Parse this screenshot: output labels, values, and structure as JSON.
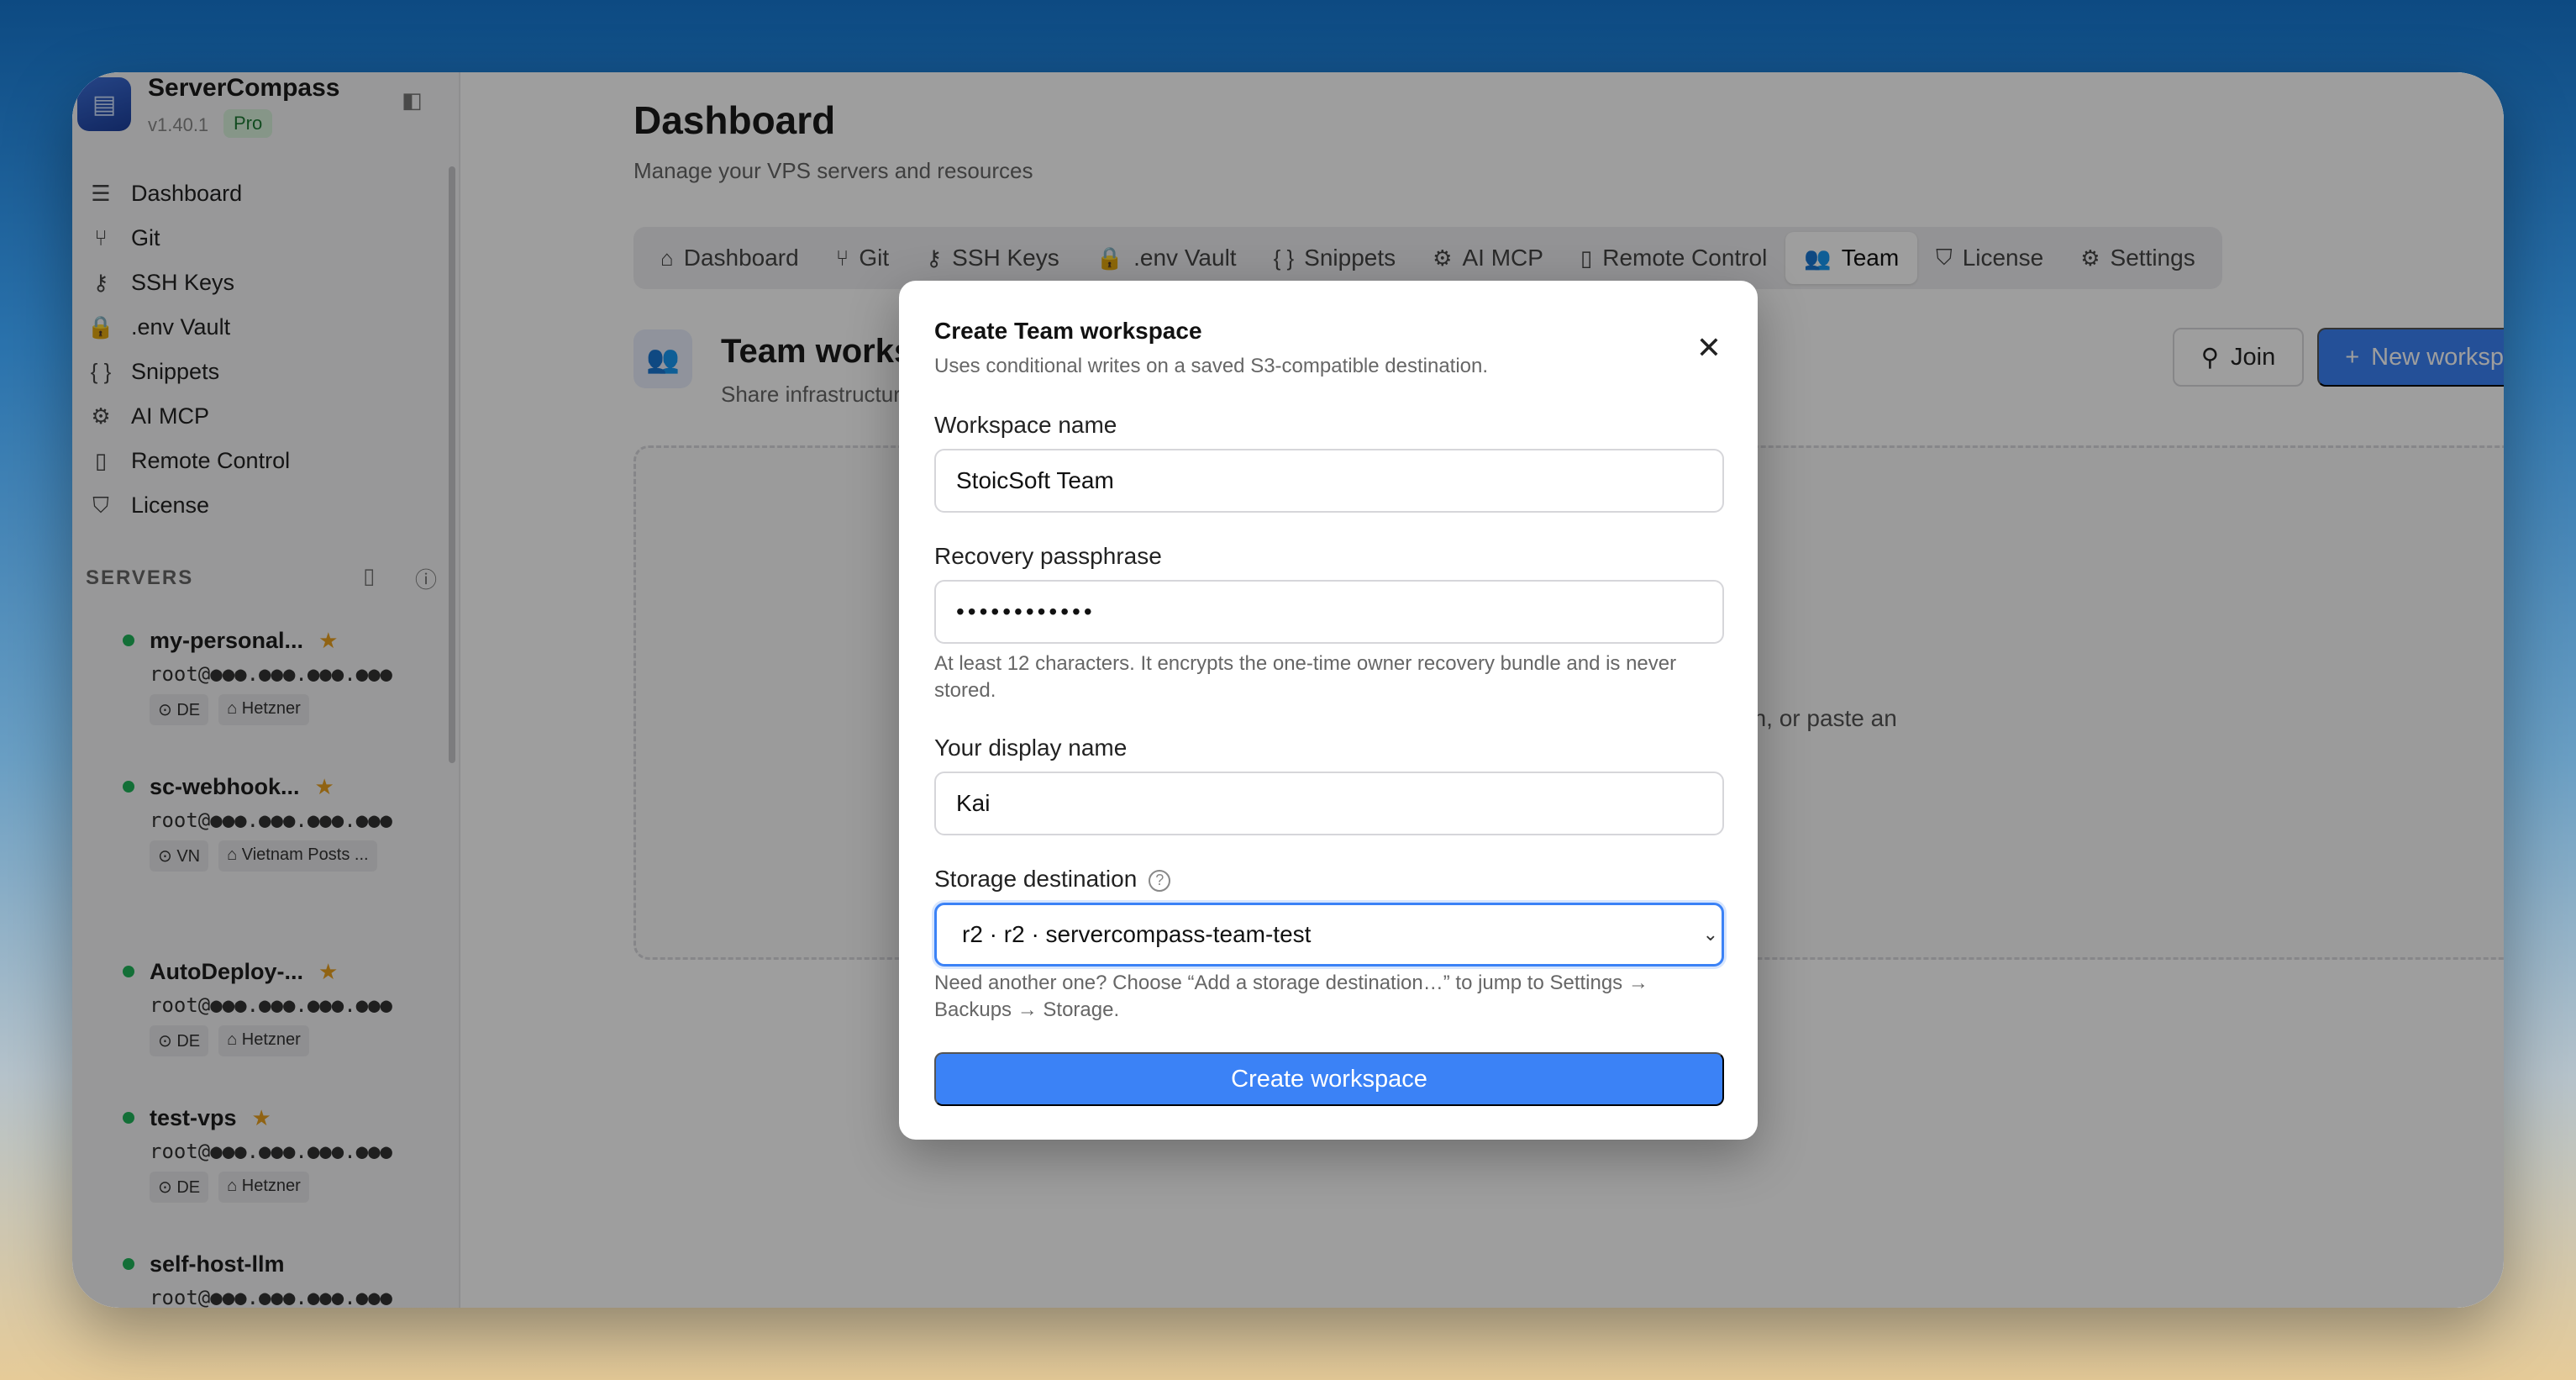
{
  "app": {
    "name": "ServerCompass",
    "version": "v1.40.1",
    "badge": "Pro"
  },
  "sidebar": {
    "nav": [
      {
        "label": "Dashboard",
        "icon": "server-stack-icon",
        "glyph": "☰"
      },
      {
        "label": "Git",
        "icon": "git-branch-icon",
        "glyph": "⑂"
      },
      {
        "label": "SSH Keys",
        "icon": "key-icon",
        "glyph": "⚷"
      },
      {
        "label": ".env Vault",
        "icon": "lock-icon",
        "glyph": "🔒"
      },
      {
        "label": "Snippets",
        "icon": "braces-icon",
        "glyph": "{ }"
      },
      {
        "label": "AI MCP",
        "icon": "robot-icon",
        "glyph": "⚙"
      },
      {
        "label": "Remote Control",
        "icon": "phone-icon",
        "glyph": "▯"
      },
      {
        "label": "License",
        "icon": "shield-icon",
        "glyph": "⛉"
      }
    ],
    "servers_title": "SERVERS",
    "servers": [
      {
        "name": "my-personal...",
        "host": "root@●●●.●●●.●●●.●●●",
        "tags": [
          "⊙ DE",
          "⌂ Hetzner"
        ]
      },
      {
        "name": "sc-webhook...",
        "host": "root@●●●.●●●.●●●.●●●",
        "tags": [
          "⊙ VN",
          "⌂ Vietnam Posts ..."
        ]
      },
      {
        "name": "AutoDeploy-...",
        "host": "root@●●●.●●●.●●●.●●●",
        "tags": [
          "⊙ DE",
          "⌂ Hetzner"
        ]
      },
      {
        "name": "test-vps",
        "host": "root@●●●.●●●.●●●.●●●",
        "tags": [
          "⊙ DE",
          "⌂ Hetzner"
        ]
      },
      {
        "name": "self-host-llm",
        "host": "root@●●●.●●●.●●●.●●●",
        "tags": []
      }
    ]
  },
  "header": {
    "title": "Dashboard",
    "subtitle": "Manage your VPS servers and resources"
  },
  "tabs": [
    {
      "label": "Dashboard",
      "icon": "home-icon",
      "glyph": "⌂"
    },
    {
      "label": "Git",
      "icon": "git-branch-icon",
      "glyph": "⑂"
    },
    {
      "label": "SSH Keys",
      "icon": "key-icon",
      "glyph": "⚷"
    },
    {
      "label": ".env Vault",
      "icon": "lock-icon",
      "glyph": "🔒"
    },
    {
      "label": "Snippets",
      "icon": "braces-icon",
      "glyph": "{ }"
    },
    {
      "label": "AI MCP",
      "icon": "robot-icon",
      "glyph": "⚙"
    },
    {
      "label": "Remote Control",
      "icon": "phone-icon",
      "glyph": "▯"
    },
    {
      "label": "Team",
      "icon": "users-icon",
      "glyph": "👥",
      "active": true
    },
    {
      "label": "License",
      "icon": "shield-check-icon",
      "glyph": "⛉"
    },
    {
      "label": "Settings",
      "icon": "gear-icon",
      "glyph": "⚙"
    }
  ],
  "team": {
    "title": "Team workspace",
    "subtitle": "Share infrastructure acce",
    "join_label": "Join",
    "new_label": "New workspace",
    "empty_text": "tion, or paste an"
  },
  "modal": {
    "title": "Create Team workspace",
    "subtitle": "Uses conditional writes on a saved S3-compatible destination.",
    "workspace_name_label": "Workspace name",
    "workspace_name_value": "StoicSoft Team",
    "passphrase_label": "Recovery passphrase",
    "passphrase_value": "••••••••••••",
    "passphrase_hint": "At least 12 characters. It encrypts the one-time owner recovery bundle and is never stored.",
    "display_name_label": "Your display name",
    "display_name_value": "Kai",
    "storage_label": "Storage destination",
    "storage_value": "r2 · r2 · servercompass-team-test",
    "storage_hint": "Need another one? Choose “Add a storage destination…” to jump to Settings → Backups → Storage.",
    "create_label": "Create workspace"
  },
  "colors": {
    "accent": "#3b82f6",
    "online": "#20b35a",
    "star": "#e8a020"
  }
}
